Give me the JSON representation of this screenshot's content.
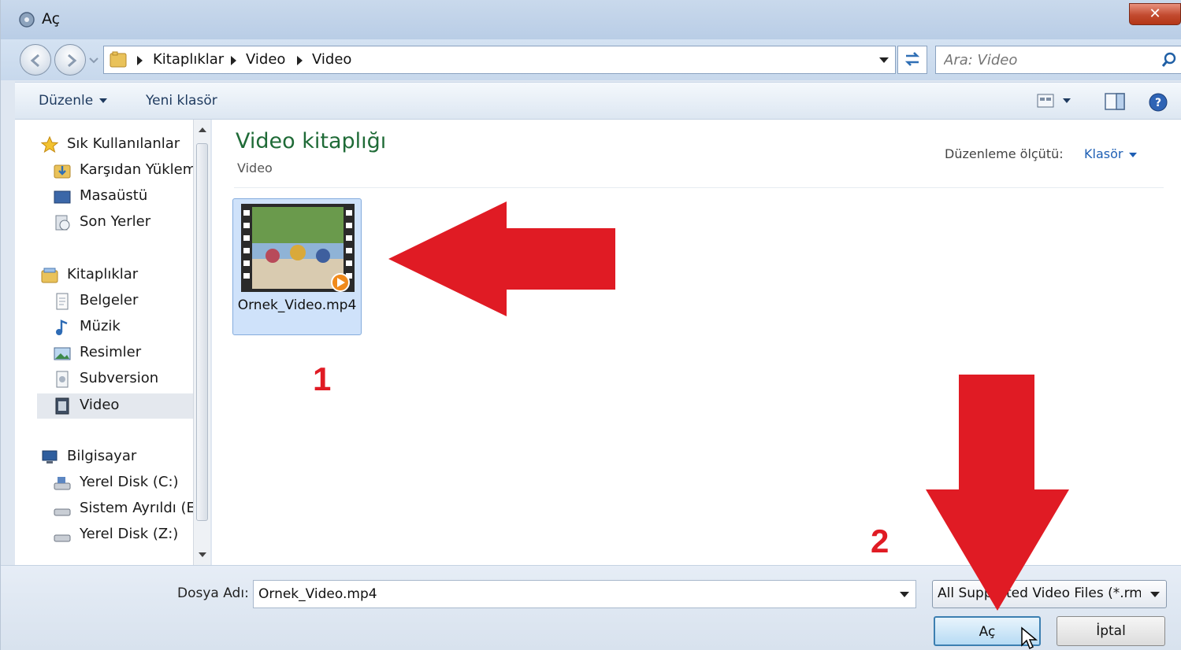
{
  "window": {
    "title": "Aç",
    "close_label": "✕"
  },
  "address": {
    "crumbs": [
      "Kitaplıklar",
      "Video",
      "Video"
    ]
  },
  "search": {
    "placeholder": "Ara: Video"
  },
  "toolbar": {
    "organize_label": "Düzenle",
    "new_folder_label": "Yeni klasör"
  },
  "sidebar": {
    "items": [
      {
        "label": "Sık Kullanılanlar",
        "icon": "star-icon"
      },
      {
        "label": "Karşıdan Yüklem",
        "icon": "downloads-folder-icon"
      },
      {
        "label": "Masaüstü",
        "icon": "desktop-icon"
      },
      {
        "label": "Son Yerler",
        "icon": "recent-places-icon"
      },
      {
        "label": "Kitaplıklar",
        "icon": "libraries-icon"
      },
      {
        "label": "Belgeler",
        "icon": "documents-icon"
      },
      {
        "label": "Müzik",
        "icon": "music-icon"
      },
      {
        "label": "Resimler",
        "icon": "pictures-icon"
      },
      {
        "label": "Subversion",
        "icon": "subversion-icon"
      },
      {
        "label": "Video",
        "icon": "video-icon"
      },
      {
        "label": "Bilgisayar",
        "icon": "computer-icon"
      },
      {
        "label": "Yerel Disk (C:)",
        "icon": "drive-icon"
      },
      {
        "label": "Sistem Ayrıldı (E:",
        "icon": "drive-icon"
      },
      {
        "label": "Yerel Disk (Z:)",
        "icon": "drive-icon"
      }
    ]
  },
  "content": {
    "title": "Video kitaplığı",
    "subtitle": "Video",
    "arrange_label": "Düzenleme ölçütü:",
    "arrange_value": "Klasör",
    "files": [
      {
        "name": "Ornek_Video.mp4"
      }
    ]
  },
  "annotations": {
    "step1": "1",
    "step2": "2",
    "color": "#e01b24"
  },
  "footer": {
    "filename_label": "Dosya Adı:",
    "filename_value": "Ornek_Video.mp4",
    "filetype_value": "All Supported Video Files (*.rm;",
    "open_label": "Aç",
    "cancel_label": "İptal"
  }
}
